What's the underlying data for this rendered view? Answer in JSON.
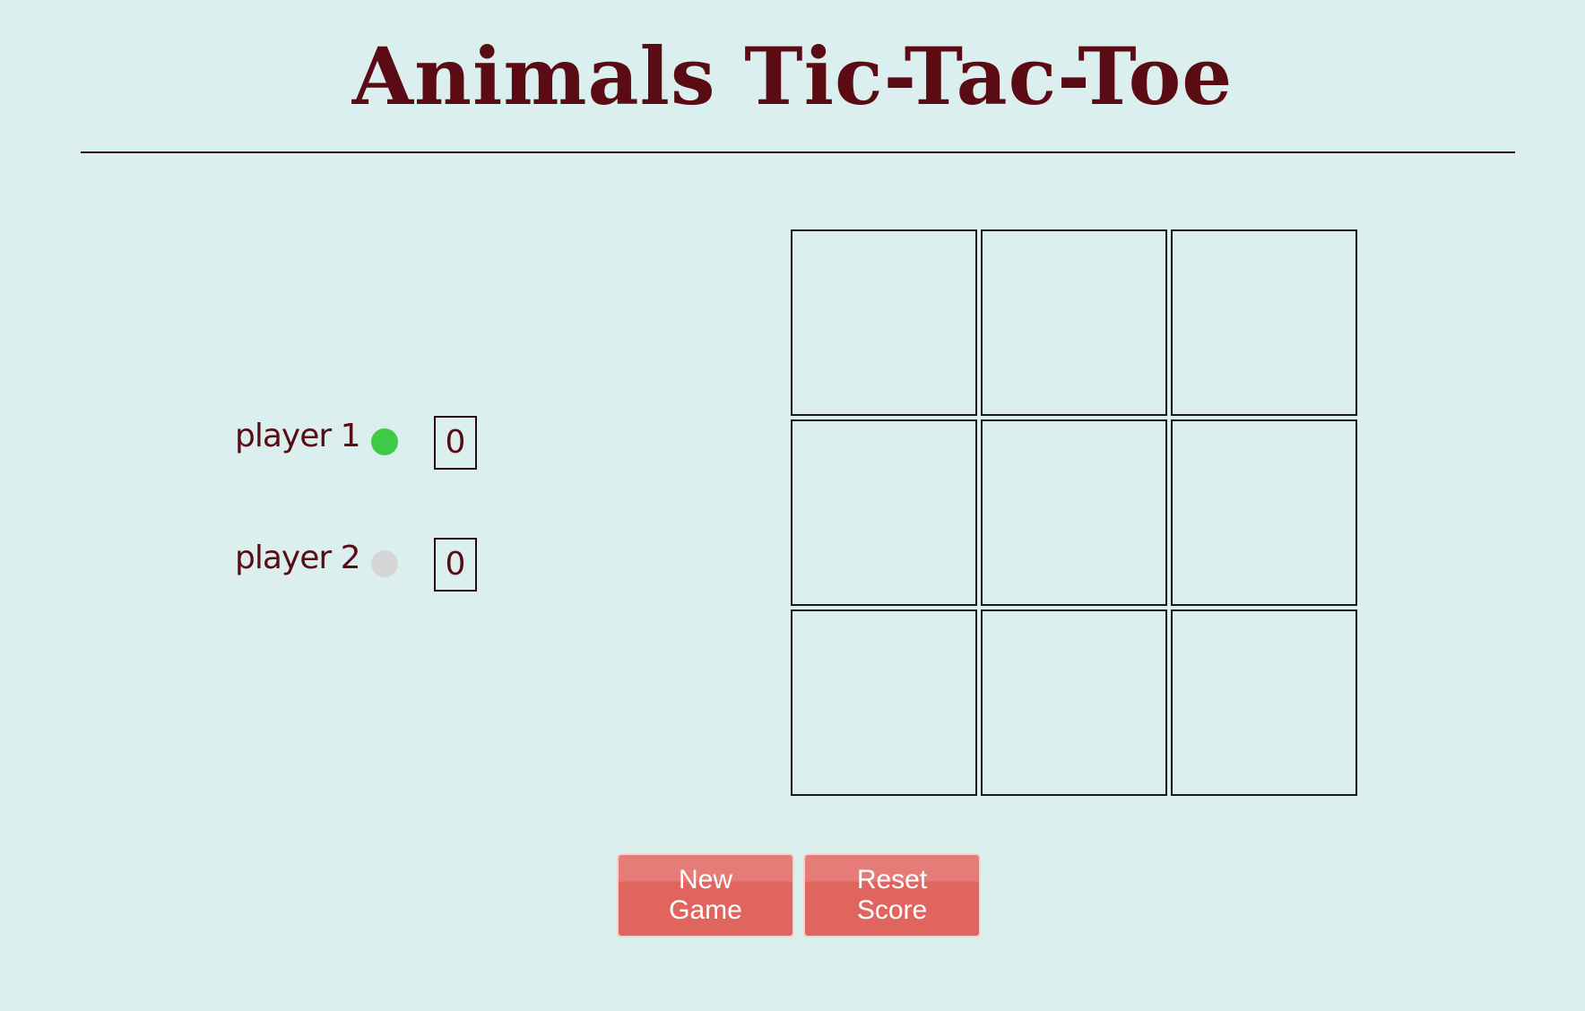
{
  "header": {
    "title": "Animals Tic-Tac-Toe"
  },
  "players": [
    {
      "label": "player 1",
      "score": "0",
      "indicator_color": "#3ec946",
      "active": true
    },
    {
      "label": "player 2",
      "score": "0",
      "indicator_color": "#d6d6d6",
      "active": false
    }
  ],
  "board": {
    "cells": [
      "",
      "",
      "",
      "",
      "",
      "",
      "",
      "",
      ""
    ]
  },
  "buttons": {
    "new_game": "New Game",
    "reset_score": "Reset Score"
  },
  "colors": {
    "background": "#dbf0ee",
    "title": "#5a0b14",
    "button": "#e1655f"
  }
}
